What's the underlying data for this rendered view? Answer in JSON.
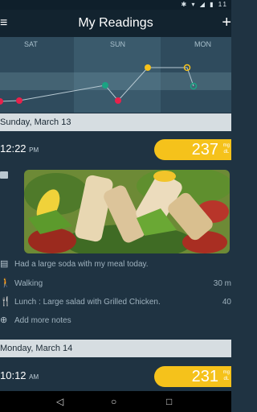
{
  "status_bar": {
    "icons": "✱ ▾ ◢ ▮ 11"
  },
  "app_bar": {
    "menu_icon": "≡",
    "title": "My Readings",
    "add_icon": "+"
  },
  "chart": {
    "days": [
      "SAT",
      "SUN",
      "MON"
    ]
  },
  "chart_data": {
    "type": "line",
    "x": [
      "SAT",
      "SAT",
      "SUN",
      "SUN",
      "SUN",
      "MON",
      "MON"
    ],
    "y": [
      null,
      null,
      null,
      null,
      null,
      null,
      null
    ],
    "title": "",
    "xlabel": "",
    "ylabel": "",
    "markers": [
      "red",
      "red",
      "teal",
      "red",
      "yellow",
      "yellow-hollow",
      "teal-hollow"
    ],
    "grid": false,
    "legend": "none"
  },
  "days": [
    {
      "header": "Sunday, March 13",
      "entry": {
        "time": "12:22",
        "ampm": "PM",
        "value": "237",
        "unit_top": "mg",
        "unit_bottom": "dL",
        "note": "Had a large soda with my meal today.",
        "activity": "Walking",
        "activity_duration": "30 m",
        "meal": "Lunch : Large salad with Grilled Chicken.",
        "meal_value": "40",
        "add_more": "Add more notes"
      }
    },
    {
      "header": "Monday, March 14",
      "entry": {
        "time": "10:12",
        "ampm": "AM",
        "value": "231",
        "unit_top": "mg",
        "unit_bottom": "dL"
      }
    }
  ],
  "nav": {
    "back": "◁",
    "home": "○",
    "recents": "□"
  },
  "colors": {
    "accent": "#f5c21b",
    "low": "#e8214b",
    "target": "#1aa383",
    "background": "#1f3342"
  }
}
